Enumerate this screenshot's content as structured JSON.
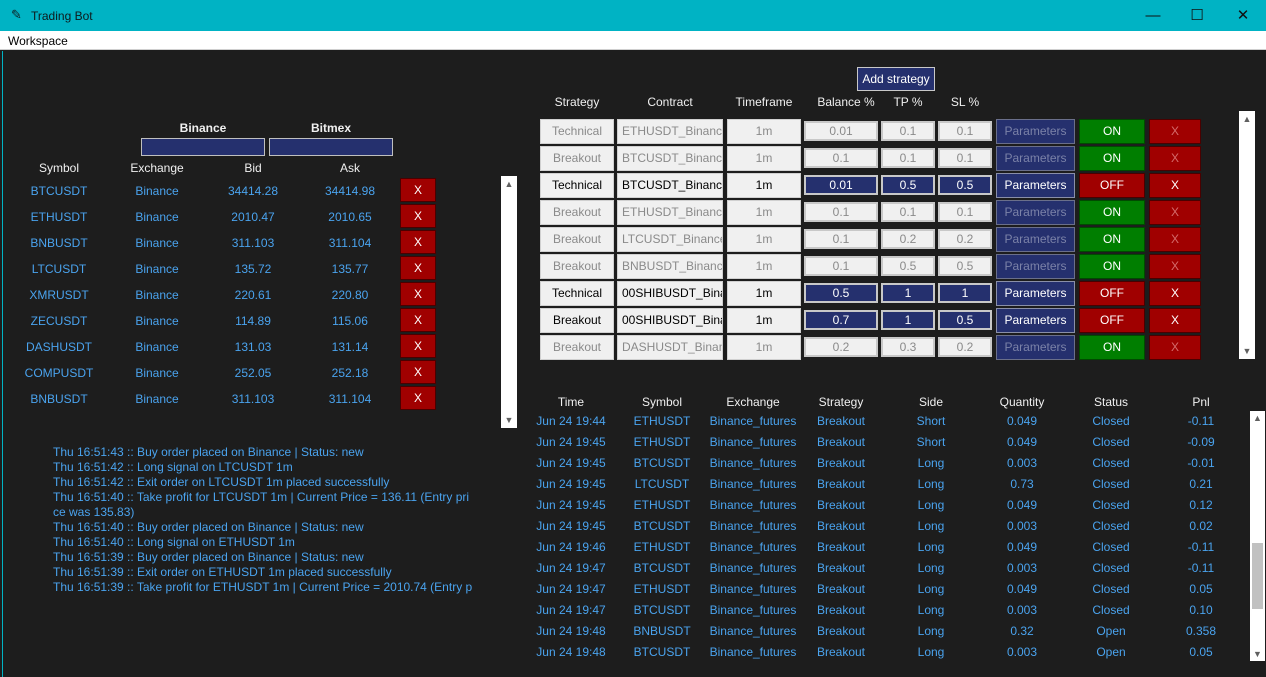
{
  "window": {
    "title": "Trading Bot",
    "minimize": "—",
    "maximize": "☐",
    "close": "✕"
  },
  "menu": {
    "workspace": "Workspace"
  },
  "watchlist": {
    "binance_label": "Binance",
    "bitmex_label": "Bitmex",
    "headers": [
      "Symbol",
      "Exchange",
      "Bid",
      "Ask"
    ],
    "remove_label": "X",
    "rows": [
      {
        "symbol": "BTCUSDT",
        "exchange": "Binance",
        "bid": "34414.28",
        "ask": "34414.98"
      },
      {
        "symbol": "ETHUSDT",
        "exchange": "Binance",
        "bid": "2010.47",
        "ask": "2010.65"
      },
      {
        "symbol": "BNBUSDT",
        "exchange": "Binance",
        "bid": "311.103",
        "ask": "311.104"
      },
      {
        "symbol": "LTCUSDT",
        "exchange": "Binance",
        "bid": "135.72",
        "ask": "135.77"
      },
      {
        "symbol": "XMRUSDT",
        "exchange": "Binance",
        "bid": "220.61",
        "ask": "220.80"
      },
      {
        "symbol": "ZECUSDT",
        "exchange": "Binance",
        "bid": "114.89",
        "ask": "115.06"
      },
      {
        "symbol": "DASHUSDT",
        "exchange": "Binance",
        "bid": "131.03",
        "ask": "131.14"
      },
      {
        "symbol": "COMPUSDT",
        "exchange": "Binance",
        "bid": "252.05",
        "ask": "252.18"
      },
      {
        "symbol": "BNBUSDT",
        "exchange": "Binance",
        "bid": "311.103",
        "ask": "311.104"
      }
    ]
  },
  "logs": [
    "Thu 16:51:43 :: Buy order placed on Binance | Status: new",
    "Thu 16:51:42 :: Long signal on LTCUSDT 1m",
    "Thu 16:51:42 :: Exit order on LTCUSDT 1m placed successfully",
    "Thu 16:51:40 :: Take profit for LTCUSDT 1m | Current Price = 136.11 (Entry pri",
    "ce was 135.83)",
    "Thu 16:51:40 :: Buy order placed on Binance | Status: new",
    "Thu 16:51:40 :: Long signal on ETHUSDT 1m",
    "Thu 16:51:39 :: Buy order placed on Binance | Status: new",
    "Thu 16:51:39 :: Exit order on ETHUSDT 1m placed successfully",
    "Thu 16:51:39 :: Take profit for ETHUSDT 1m | Current Price = 2010.74 (Entry p"
  ],
  "strategies": {
    "add_label": "Add strategy",
    "headers": [
      "Strategy",
      "Contract",
      "Timeframe",
      "Balance %",
      "TP %",
      "SL %"
    ],
    "parameters_label": "Parameters",
    "remove_label": "X",
    "rows": [
      {
        "strategy": "Technical",
        "contract": "ETHUSDT_Binance",
        "timeframe": "1m",
        "balance": "0.01",
        "tp": "0.1",
        "sl": "0.1",
        "status": "ON",
        "active": true
      },
      {
        "strategy": "Breakout",
        "contract": "BTCUSDT_Binance",
        "timeframe": "1m",
        "balance": "0.1",
        "tp": "0.1",
        "sl": "0.1",
        "status": "ON",
        "active": true
      },
      {
        "strategy": "Technical",
        "contract": "BTCUSDT_Binance",
        "timeframe": "1m",
        "balance": "0.01",
        "tp": "0.5",
        "sl": "0.5",
        "status": "OFF",
        "active": false
      },
      {
        "strategy": "Breakout",
        "contract": "ETHUSDT_Binance",
        "timeframe": "1m",
        "balance": "0.1",
        "tp": "0.1",
        "sl": "0.1",
        "status": "ON",
        "active": true
      },
      {
        "strategy": "Breakout",
        "contract": "LTCUSDT_Binance",
        "timeframe": "1m",
        "balance": "0.1",
        "tp": "0.2",
        "sl": "0.2",
        "status": "ON",
        "active": true
      },
      {
        "strategy": "Breakout",
        "contract": "BNBUSDT_Binance",
        "timeframe": "1m",
        "balance": "0.1",
        "tp": "0.5",
        "sl": "0.5",
        "status": "ON",
        "active": true
      },
      {
        "strategy": "Technical",
        "contract": "00SHIBUSDT_Binan",
        "timeframe": "1m",
        "balance": "0.5",
        "tp": "1",
        "sl": "1",
        "status": "OFF",
        "active": false
      },
      {
        "strategy": "Breakout",
        "contract": "00SHIBUSDT_Binan",
        "timeframe": "1m",
        "balance": "0.7",
        "tp": "1",
        "sl": "0.5",
        "status": "OFF",
        "active": false
      },
      {
        "strategy": "Breakout",
        "contract": "DASHUSDT_Binance",
        "timeframe": "1m",
        "balance": "0.2",
        "tp": "0.3",
        "sl": "0.2",
        "status": "ON",
        "active": true
      }
    ]
  },
  "trades": {
    "headers": [
      "Time",
      "Symbol",
      "Exchange",
      "Strategy",
      "Side",
      "Quantity",
      "Status",
      "Pnl"
    ],
    "rows": [
      {
        "time": "Jun 24 19:44",
        "symbol": "ETHUSDT",
        "exchange": "Binance_futures",
        "strategy": "Breakout",
        "side": "Short",
        "quantity": "0.049",
        "status": "Closed",
        "pnl": "-0.11"
      },
      {
        "time": "Jun 24 19:45",
        "symbol": "ETHUSDT",
        "exchange": "Binance_futures",
        "strategy": "Breakout",
        "side": "Short",
        "quantity": "0.049",
        "status": "Closed",
        "pnl": "-0.09"
      },
      {
        "time": "Jun 24 19:45",
        "symbol": "BTCUSDT",
        "exchange": "Binance_futures",
        "strategy": "Breakout",
        "side": "Long",
        "quantity": "0.003",
        "status": "Closed",
        "pnl": "-0.01"
      },
      {
        "time": "Jun 24 19:45",
        "symbol": "LTCUSDT",
        "exchange": "Binance_futures",
        "strategy": "Breakout",
        "side": "Long",
        "quantity": "0.73",
        "status": "Closed",
        "pnl": "0.21"
      },
      {
        "time": "Jun 24 19:45",
        "symbol": "ETHUSDT",
        "exchange": "Binance_futures",
        "strategy": "Breakout",
        "side": "Long",
        "quantity": "0.049",
        "status": "Closed",
        "pnl": "0.12"
      },
      {
        "time": "Jun 24 19:45",
        "symbol": "BTCUSDT",
        "exchange": "Binance_futures",
        "strategy": "Breakout",
        "side": "Long",
        "quantity": "0.003",
        "status": "Closed",
        "pnl": "0.02"
      },
      {
        "time": "Jun 24 19:46",
        "symbol": "ETHUSDT",
        "exchange": "Binance_futures",
        "strategy": "Breakout",
        "side": "Long",
        "quantity": "0.049",
        "status": "Closed",
        "pnl": "-0.11"
      },
      {
        "time": "Jun 24 19:47",
        "symbol": "BTCUSDT",
        "exchange": "Binance_futures",
        "strategy": "Breakout",
        "side": "Long",
        "quantity": "0.003",
        "status": "Closed",
        "pnl": "-0.11"
      },
      {
        "time": "Jun 24 19:47",
        "symbol": "ETHUSDT",
        "exchange": "Binance_futures",
        "strategy": "Breakout",
        "side": "Long",
        "quantity": "0.049",
        "status": "Closed",
        "pnl": "0.05"
      },
      {
        "time": "Jun 24 19:47",
        "symbol": "BTCUSDT",
        "exchange": "Binance_futures",
        "strategy": "Breakout",
        "side": "Long",
        "quantity": "0.003",
        "status": "Closed",
        "pnl": "0.10"
      },
      {
        "time": "Jun 24 19:48",
        "symbol": "BNBUSDT",
        "exchange": "Binance_futures",
        "strategy": "Breakout",
        "side": "Long",
        "quantity": "0.32",
        "status": "Open",
        "pnl": "0.358"
      },
      {
        "time": "Jun 24 19:48",
        "symbol": "BTCUSDT",
        "exchange": "Binance_futures",
        "strategy": "Breakout",
        "side": "Long",
        "quantity": "0.003",
        "status": "Open",
        "pnl": "0.05"
      }
    ]
  },
  "colors": {
    "titlebar": "#00b3c4",
    "background": "#1d1d1d",
    "text_blue": "#4aa3ee",
    "dark_blue": "#25306e",
    "red": "#a00000",
    "green": "#007e00"
  }
}
